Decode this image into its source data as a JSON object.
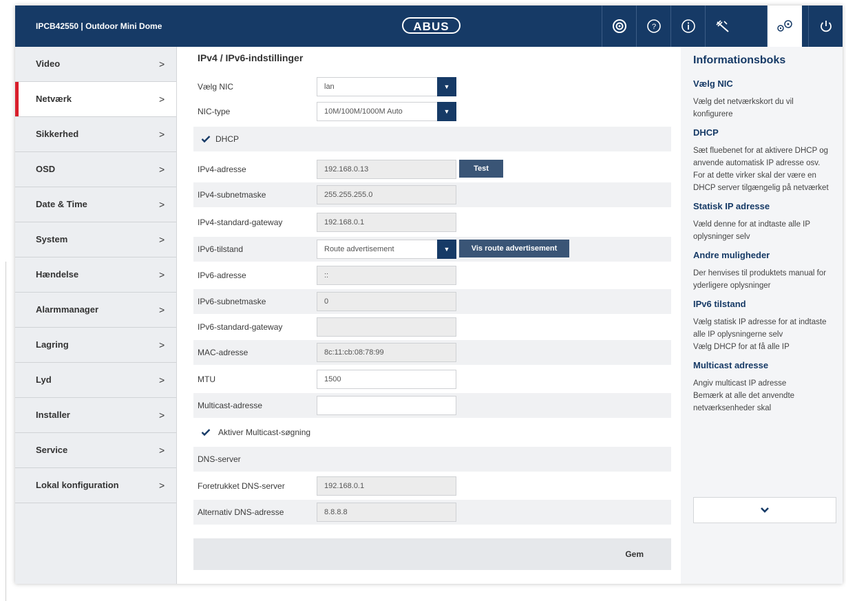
{
  "header": {
    "device": "IPCB42550  |  Outdoor Mini Dome",
    "logo": "ABUS",
    "buttons": [
      "camera-icon",
      "help-icon",
      "info-icon",
      "tools-icon",
      "settings-icon",
      "power-icon"
    ],
    "active_button": "settings-icon"
  },
  "sidebar": {
    "items": [
      {
        "label": "Video"
      },
      {
        "label": "Netværk"
      },
      {
        "label": "Sikkerhed"
      },
      {
        "label": "OSD"
      },
      {
        "label": "Date & Time"
      },
      {
        "label": "System"
      },
      {
        "label": "Hændelse"
      },
      {
        "label": "Alarmmanager"
      },
      {
        "label": "Lagring"
      },
      {
        "label": "Lyd"
      },
      {
        "label": "Installer"
      },
      {
        "label": "Service"
      },
      {
        "label": "Lokal konfiguration"
      }
    ],
    "active": "Netværk",
    "chevron": ">"
  },
  "main": {
    "title": "IPv4 / IPv6-indstillinger",
    "nic": {
      "label": "Vælg NIC",
      "value": "lan"
    },
    "nic_type": {
      "label": "NIC-type",
      "value": "10M/100M/1000M Auto"
    },
    "dhcp": {
      "label": "DHCP",
      "checked": true
    },
    "ipv4_address": {
      "label": "IPv4-adresse",
      "value": "192.168.0.13",
      "button": "Test"
    },
    "ipv4_subnet": {
      "label": "IPv4-subnetmaske",
      "value": "255.255.255.0"
    },
    "ipv4_gateway": {
      "label": "IPv4-standard-gateway",
      "value": "192.168.0.1"
    },
    "ipv6_mode": {
      "label": "IPv6-tilstand",
      "value": "Route advertisement",
      "button": "Vis route advertisement"
    },
    "ipv6_address": {
      "label": "IPv6-adresse",
      "value": "::"
    },
    "ipv6_subnet": {
      "label": "IPv6-subnetmaske",
      "value": "0"
    },
    "ipv6_gateway": {
      "label": "IPv6-standard-gateway",
      "value": ""
    },
    "mac": {
      "label": "MAC-adresse",
      "value": "8c:11:cb:08:78:99"
    },
    "mtu": {
      "label": "MTU",
      "value": "1500"
    },
    "multicast": {
      "label": "Multicast-adresse",
      "value": ""
    },
    "multicast_search": {
      "label": "Aktiver Multicast-søgning",
      "checked": true
    },
    "dns_section": "DNS-server",
    "dns_preferred": {
      "label": "Foretrukket DNS-server",
      "value": "192.168.0.1"
    },
    "dns_alternative": {
      "label": "Alternativ DNS-adresse",
      "value": "8.8.8.8"
    },
    "save": "Gem"
  },
  "info": {
    "title": "Informationsboks",
    "sections": [
      {
        "heading": "Vælg NIC",
        "lines": [
          "Vælg det netværkskort du vil konfigurere"
        ]
      },
      {
        "heading": "DHCP",
        "lines": [
          "Sæt fluebenet for at aktivere DHCP og anvende automatisk IP adresse osv.",
          "For at dette virker skal der være en DHCP server tilgængelig på netværket"
        ]
      },
      {
        "heading": "Statisk IP adresse",
        "lines": [
          "Væld denne for at indtaste alle IP oplysninger selv"
        ]
      },
      {
        "heading": "Andre muligheder",
        "lines": [
          "Der henvises til produktets manual for yderligere oplysninger"
        ]
      },
      {
        "heading": "IPv6 tilstand",
        "lines": [
          "Vælg statisk IP adresse for at indtaste alle IP oplysningerne selv",
          "Vælg DHCP for at få alle IP"
        ]
      },
      {
        "heading": "Multicast adresse",
        "lines": [
          "Angiv multicast IP adresse",
          "Bemærk at alle det anvendte netværksenheder skal"
        ]
      }
    ]
  },
  "colors": {
    "header": "#163a66",
    "accent": "#d81e2b",
    "button": "#3a5576"
  }
}
